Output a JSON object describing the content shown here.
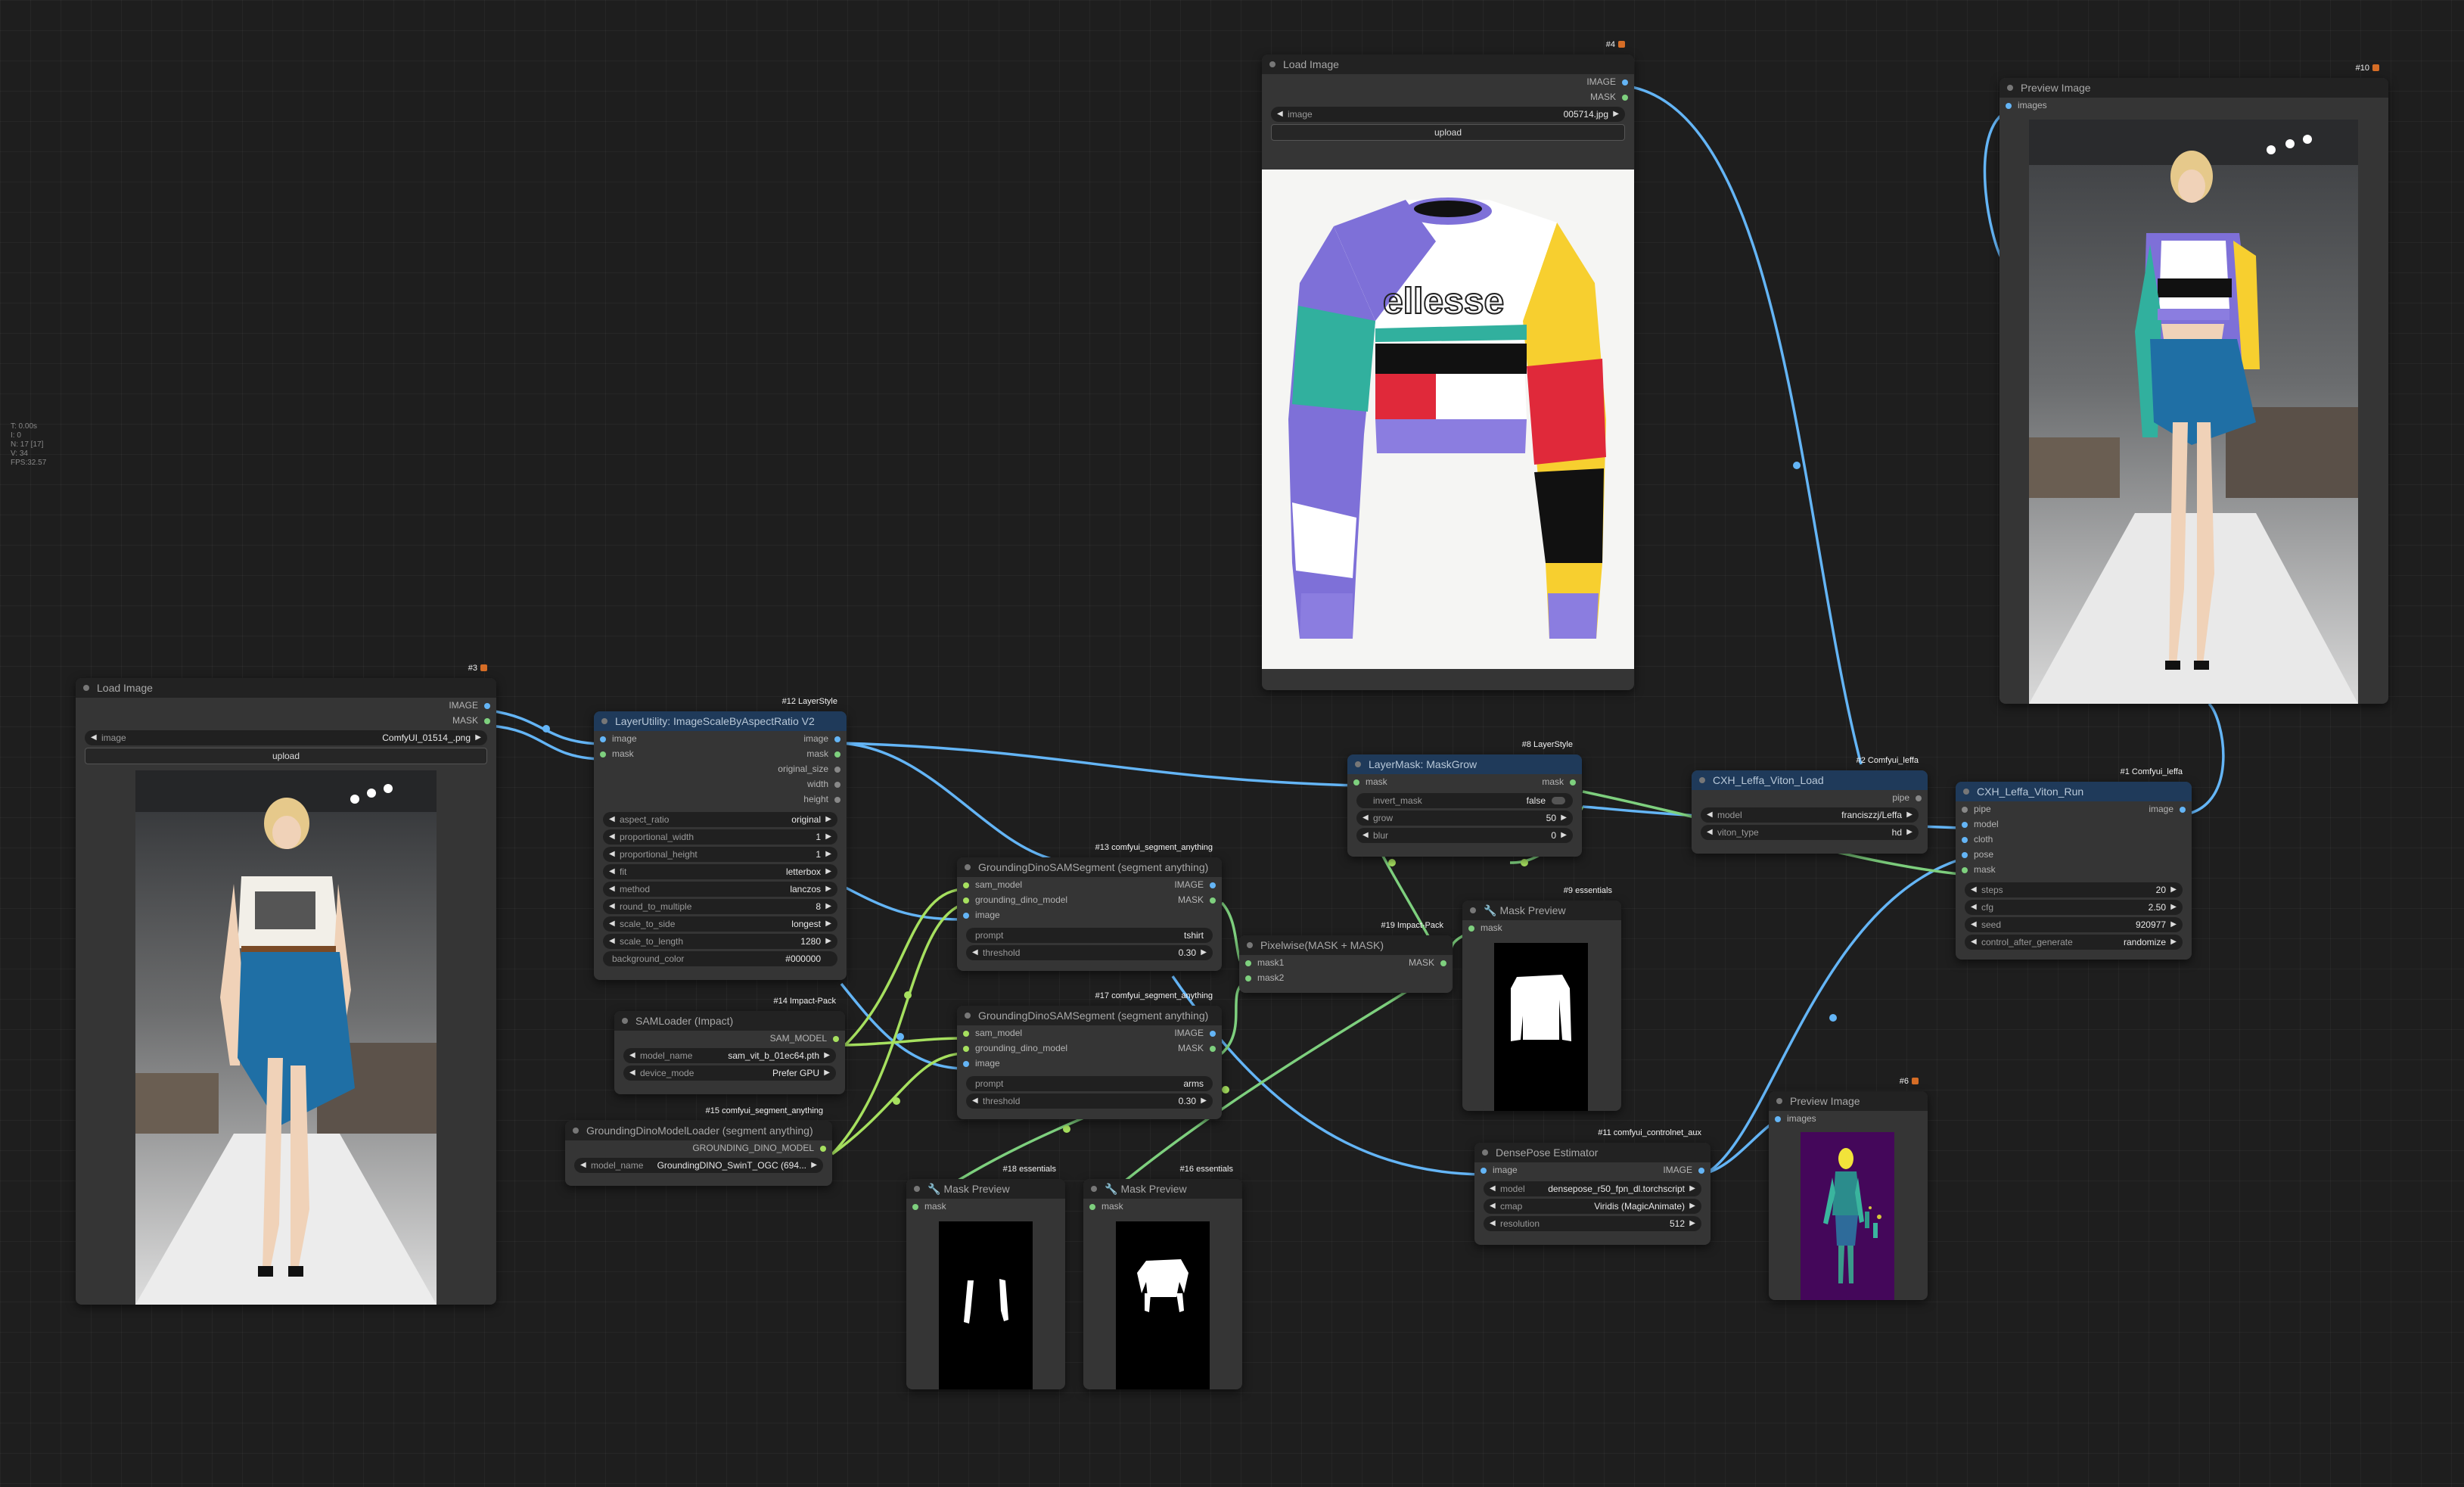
{
  "stats": [
    "T: 0.00s",
    "I: 0",
    "N: 17 [17]",
    "V: 34",
    "FPS:32.57"
  ],
  "nodes": {
    "load_cloth": {
      "tag": "#4",
      "title": "Load Image",
      "outputs": [
        "IMAGE",
        "MASK"
      ],
      "image_label": "image",
      "image_value": "005714.jpg",
      "upload_label": "upload"
    },
    "preview_result": {
      "tag": "#10",
      "title": "Preview Image",
      "inputs": [
        "images"
      ]
    },
    "load_person": {
      "tag": "#3",
      "title": "Load Image",
      "outputs": [
        "IMAGE",
        "MASK"
      ],
      "image_label": "image",
      "image_value": "ComfyUI_01514_.png",
      "upload_label": "upload"
    },
    "layer_scale": {
      "tag": "#12 LayerStyle",
      "title": "LayerUtility: ImageScaleByAspectRatio V2",
      "inputs": [
        "image",
        "mask"
      ],
      "outputs": [
        "image",
        "mask",
        "original_size",
        "width",
        "height"
      ],
      "widgets": [
        {
          "label": "aspect_ratio",
          "value": "original"
        },
        {
          "label": "proportional_width",
          "value": "1"
        },
        {
          "label": "proportional_height",
          "value": "1"
        },
        {
          "label": "fit",
          "value": "letterbox"
        },
        {
          "label": "method",
          "value": "lanczos"
        },
        {
          "label": "round_to_multiple",
          "value": "8"
        },
        {
          "label": "scale_to_side",
          "value": "longest"
        },
        {
          "label": "scale_to_length",
          "value": "1280"
        },
        {
          "label": "background_color",
          "value": "#000000"
        }
      ]
    },
    "gdsam1": {
      "tag": "#13 comfyui_segment_anything",
      "title": "GroundingDinoSAMSegment (segment anything)",
      "inputs": [
        "sam_model",
        "grounding_dino_model",
        "image"
      ],
      "outputs": [
        "IMAGE",
        "MASK"
      ],
      "prompt_label": "prompt",
      "prompt_value": "tshirt",
      "threshold_label": "threshold",
      "threshold_value": "0.30"
    },
    "gdsam2": {
      "tag": "#17 comfyui_segment_anything",
      "title": "GroundingDinoSAMSegment (segment anything)",
      "inputs": [
        "sam_model",
        "grounding_dino_model",
        "image"
      ],
      "outputs": [
        "IMAGE",
        "MASK"
      ],
      "prompt_label": "prompt",
      "prompt_value": "arms",
      "threshold_label": "threshold",
      "threshold_value": "0.30"
    },
    "samloader": {
      "tag": "#14 Impact-Pack",
      "title": "SAMLoader (Impact)",
      "outputs": [
        "SAM_MODEL"
      ],
      "widgets": [
        {
          "label": "model_name",
          "value": "sam_vit_b_01ec64.pth"
        },
        {
          "label": "device_mode",
          "value": "Prefer GPU"
        }
      ]
    },
    "gdloader": {
      "tag": "#15 comfyui_segment_anything",
      "title": "GroundingDinoModelLoader (segment anything)",
      "outputs": [
        "GROUNDING_DINO_MODEL"
      ],
      "widgets": [
        {
          "label": "model_name",
          "value": "GroundingDINO_SwinT_OGC (694..."
        }
      ]
    },
    "maskgrow": {
      "tag": "#8 LayerStyle",
      "title": "LayerMask: MaskGrow",
      "inputs": [
        "mask"
      ],
      "outputs": [
        "mask"
      ],
      "widgets": [
        {
          "label": "invert_mask",
          "value": "false"
        },
        {
          "label": "grow",
          "value": "50"
        },
        {
          "label": "blur",
          "value": "0"
        }
      ]
    },
    "pixelwise": {
      "tag": "#19 Impact-Pack",
      "title": "Pixelwise(MASK + MASK)",
      "inputs": [
        "mask1",
        "mask2"
      ],
      "outputs": [
        "MASK"
      ]
    },
    "maskpreview9": {
      "tag": "#9 essentials",
      "title": "Mask Preview",
      "inputs": [
        "mask"
      ]
    },
    "maskpreview18": {
      "tag": "#18 essentials",
      "title": "Mask Preview",
      "inputs": [
        "mask"
      ]
    },
    "maskpreview16": {
      "tag": "#16 essentials",
      "title": "Mask Preview",
      "inputs": [
        "mask"
      ]
    },
    "viton_load": {
      "tag": "#2 Comfyui_leffa",
      "title": "CXH_Leffa_Viton_Load",
      "outputs": [
        "pipe"
      ],
      "widgets": [
        {
          "label": "model",
          "value": "franciszzj/Leffa"
        },
        {
          "label": "viton_type",
          "value": "hd"
        }
      ]
    },
    "viton_run": {
      "tag": "#1 Comfyui_leffa",
      "title": "CXH_Leffa_Viton_Run",
      "inputs": [
        "pipe",
        "model",
        "cloth",
        "pose",
        "mask"
      ],
      "outputs": [
        "image"
      ],
      "widgets": [
        {
          "label": "steps",
          "value": "20"
        },
        {
          "label": "cfg",
          "value": "2.50"
        },
        {
          "label": "seed",
          "value": "920977"
        },
        {
          "label": "control_after_generate",
          "value": "randomize"
        }
      ]
    },
    "densepose": {
      "tag": "#11 comfyui_controlnet_aux",
      "title": "DensePose Estimator",
      "inputs": [
        "image"
      ],
      "outputs": [
        "IMAGE"
      ],
      "widgets": [
        {
          "label": "model",
          "value": "densepose_r50_fpn_dl.torchscript"
        },
        {
          "label": "cmap",
          "value": "Viridis (MagicAnimate)"
        },
        {
          "label": "resolution",
          "value": "512"
        }
      ]
    },
    "preview6": {
      "tag": "#6",
      "title": "Preview Image",
      "inputs": [
        "images"
      ]
    }
  },
  "cloth_print": "ellesse",
  "colors": {
    "link_image": "#64b5f6",
    "link_mask": "#7ed07e",
    "node_bg": "#353535",
    "header_blue": "#1f3a5a"
  }
}
